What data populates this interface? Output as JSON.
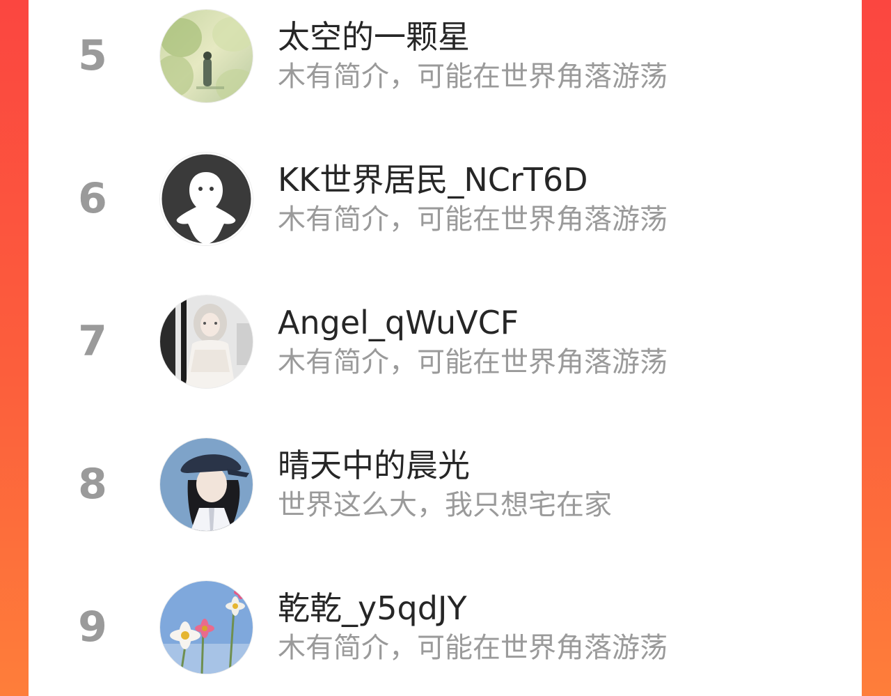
{
  "colors": {
    "background_gradient_top": "#fb4640",
    "background_gradient_bottom": "#fe7e3a",
    "panel": "#ffffff",
    "rank_text": "#9a9a9a",
    "name_text": "#262626",
    "bio_text": "#9a9a9a"
  },
  "users": [
    {
      "rank": "5",
      "name": "太空的一颗星",
      "bio": "木有简介，可能在世界角落游荡",
      "avatar": "landscape-painting-avatar"
    },
    {
      "rank": "6",
      "name": "KK世界居民_NCrT6D",
      "bio": "木有简介，可能在世界角落游荡",
      "avatar": "default-ghost-avatar"
    },
    {
      "rank": "7",
      "name": "Angel_qWuVCF",
      "bio": "木有简介，可能在世界角落游荡",
      "avatar": "girl-white-dress-avatar"
    },
    {
      "rank": "8",
      "name": "晴天中的晨光",
      "bio": "世界这么大，我只想宅在家",
      "avatar": "girl-cap-illustration-avatar"
    },
    {
      "rank": "9",
      "name": "乾乾_y5qdJY",
      "bio": "木有简介，可能在世界角落游荡",
      "avatar": "flowers-sky-avatar"
    }
  ]
}
